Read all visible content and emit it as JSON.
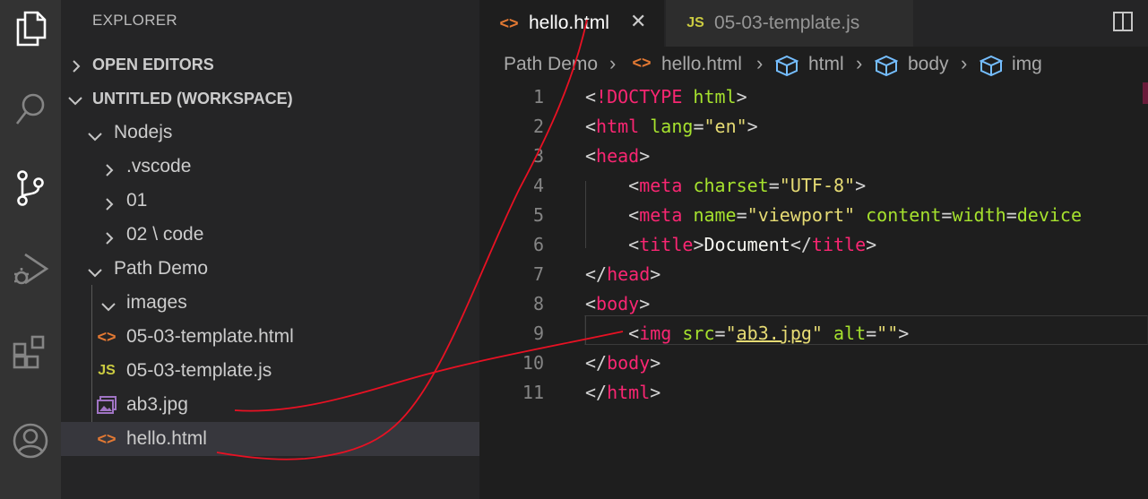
{
  "sidebar": {
    "title": "EXPLORER",
    "open_editors": "OPEN EDITORS",
    "workspace": "UNTITLED (WORKSPACE)",
    "tree": [
      {
        "label": "Nodejs"
      },
      {
        "label": ".vscode"
      },
      {
        "label": "01"
      },
      {
        "label": "02 \\ code"
      },
      {
        "label": "Path Demo"
      },
      {
        "label": "images"
      },
      {
        "label": "05-03-template.html",
        "icon": "html-file-icon"
      },
      {
        "label": "05-03-template.js",
        "icon": "js-file-icon",
        "badge": "JS"
      },
      {
        "label": "ab3.jpg",
        "icon": "image-file-icon"
      },
      {
        "label": "hello.html",
        "icon": "html-file-icon"
      }
    ]
  },
  "tabs": [
    {
      "label": "hello.html",
      "icon": "html-file-icon",
      "active": true
    },
    {
      "label": "05-03-template.js",
      "icon": "js-file-icon",
      "badge": "JS",
      "active": false
    }
  ],
  "breadcrumb": [
    "Path Demo",
    "hello.html",
    "html",
    "body",
    "img"
  ],
  "code": {
    "line_numbers": [
      "1",
      "2",
      "3",
      "4",
      "5",
      "6",
      "7",
      "8",
      "9",
      "10",
      "11"
    ],
    "lines": [
      "<!DOCTYPE html>",
      "<html lang=\"en\">",
      "<head>",
      "    <meta charset=\"UTF-8\">",
      "    <meta name=\"viewport\" content=\"width=device",
      "    <title>Document</title>",
      "</head>",
      "<body>",
      "    <img src=\"ab3.jpg\" alt=\"\">",
      "</body>",
      "</html>"
    ]
  },
  "colors": {
    "tag": "#f92672",
    "attr": "#a6e22e",
    "string": "#e6db74",
    "annotation": "#e81123"
  }
}
